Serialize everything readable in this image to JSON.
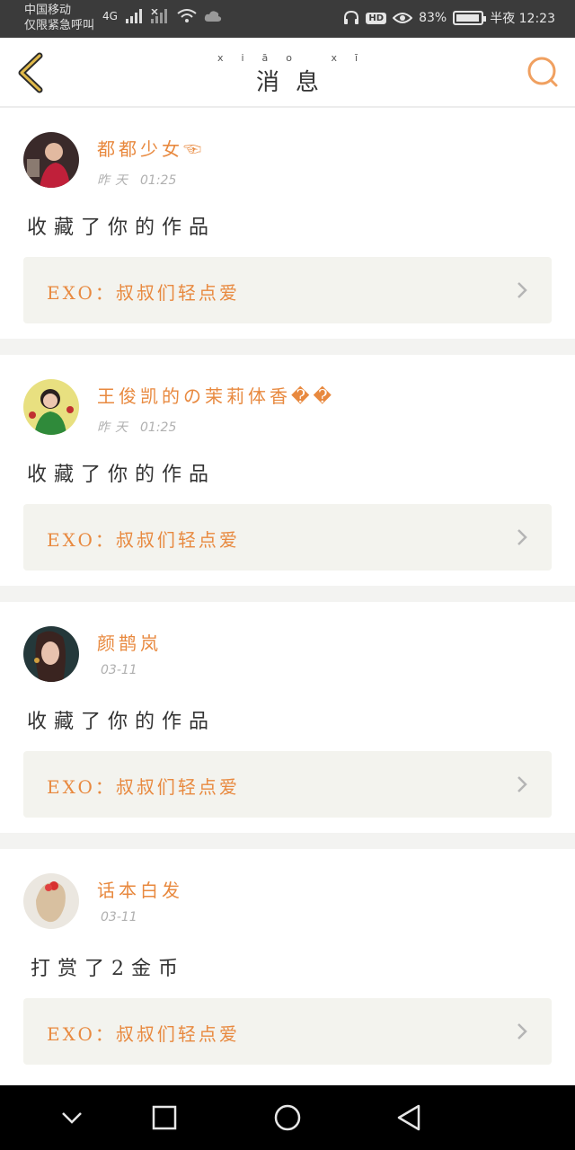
{
  "status_bar": {
    "carrier_line1": "中国移动",
    "carrier_line2": "仅限紧急呼叫",
    "network": "4G",
    "battery": "83%",
    "battery_level": 0.83,
    "time": "半夜 12:23"
  },
  "header": {
    "title_pinyin": "xiāo xī",
    "title": "消息",
    "back_icon": "chevron-left-icon",
    "search_icon": "search-icon"
  },
  "colors": {
    "accent": "#e8893f",
    "card_link_bg": "#f3f3ee",
    "separator": "#f3f3f1"
  },
  "messages": [
    {
      "username": "都都少女☜",
      "day": "昨天",
      "time": "01:25",
      "action": "收藏了你的作品",
      "work_title": "EXO：叔叔们轻点爱"
    },
    {
      "username": "王俊凯的の茉莉体香��",
      "day": "昨天",
      "time": "01:25",
      "action": "收藏了你的作品",
      "work_title": "EXO：叔叔们轻点爱"
    },
    {
      "username": "颜鹊岚",
      "day": "",
      "time": "03-11",
      "action": "收藏了你的作品",
      "work_title": "EXO：叔叔们轻点爱"
    },
    {
      "username": "话本白发",
      "day": "",
      "time": "03-11",
      "action": "打赏了2金币",
      "work_title": "EXO：叔叔们轻点爱"
    }
  ],
  "nav_bar": {
    "icons": [
      "collapse-icon",
      "recent-apps-icon",
      "home-icon",
      "back-icon"
    ]
  }
}
